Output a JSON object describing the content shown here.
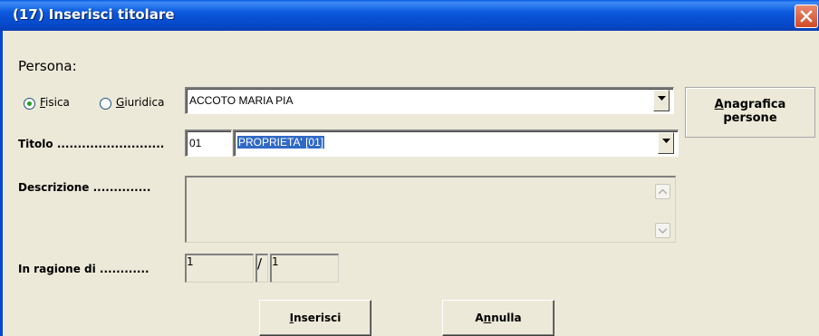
{
  "window": {
    "title": "(17) Inserisci titolare",
    "close_icon": "close-icon"
  },
  "persona": {
    "heading": "Persona:",
    "radio_fisica": {
      "label_pre": "",
      "accel": "F",
      "label_post": "isica",
      "selected": true
    },
    "radio_giuridica": {
      "label_pre": "",
      "accel": "G",
      "label_post": "iuridica",
      "selected": false
    },
    "name_value": "ACCOTO MARIA PIA"
  },
  "anagrafica_button": {
    "accel": "A",
    "line1_rest": "nagrafica",
    "line2": "persone"
  },
  "titolo": {
    "label": "Titolo ..........................",
    "code_value": "01",
    "selected_value": "PROPRIETA' [01]"
  },
  "descrizione": {
    "label": "Descrizione ..............",
    "value": ""
  },
  "ragione": {
    "label": "In ragione di ............",
    "numerator": "1",
    "separator": "/",
    "denominator": "1"
  },
  "buttons": {
    "inserisci": {
      "accel": "I",
      "rest": "nserisci"
    },
    "annulla": {
      "pre": "A",
      "accel": "n",
      "rest": "nulla"
    }
  },
  "colors": {
    "title_bar": "#0A5AE6",
    "selection": "#316AC5",
    "dialog_bg": "#ECE9D8"
  }
}
